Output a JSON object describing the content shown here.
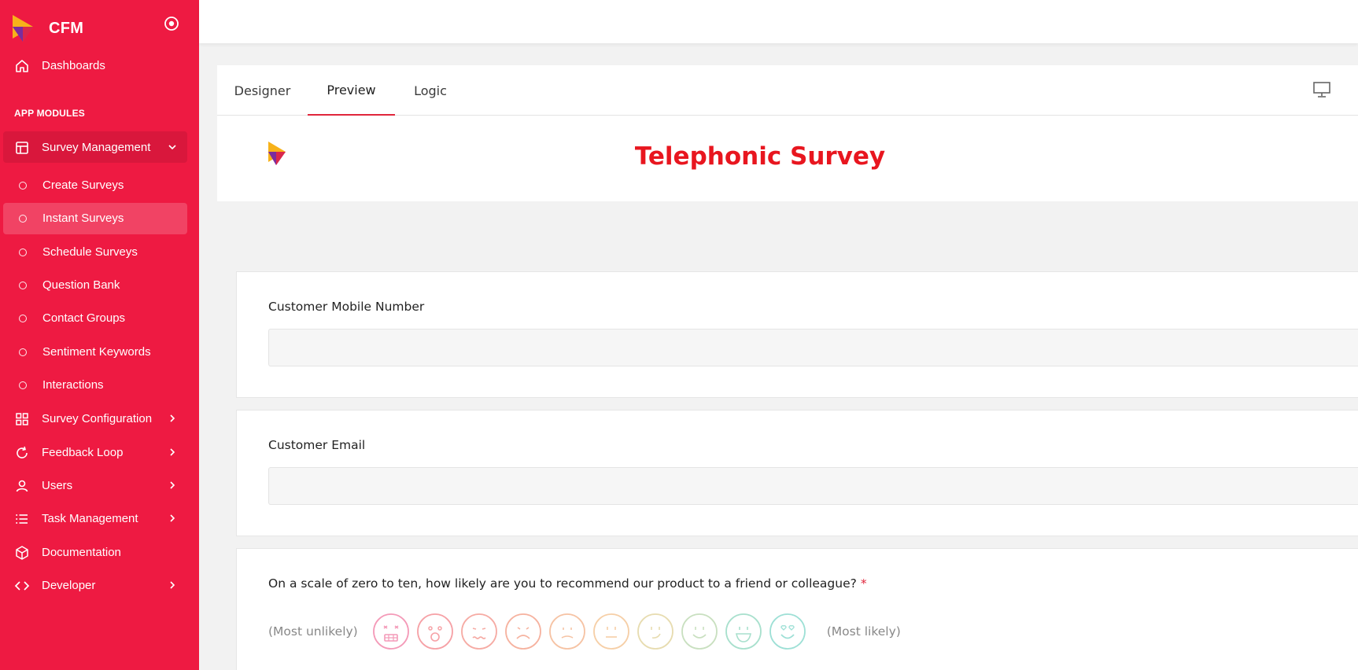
{
  "app": {
    "name": "CFM"
  },
  "sidebar": {
    "dashboards": "Dashboards",
    "section_title": "APP MODULES",
    "survey_management": "Survey Management",
    "sub_items": [
      {
        "label": "Create Surveys"
      },
      {
        "label": "Instant Surveys"
      },
      {
        "label": "Schedule Surveys"
      },
      {
        "label": "Question Bank"
      },
      {
        "label": "Contact Groups"
      },
      {
        "label": "Sentiment Keywords"
      },
      {
        "label": "Interactions"
      }
    ],
    "survey_configuration": "Survey Configuration",
    "feedback_loop": "Feedback Loop",
    "users": "Users",
    "task_management": "Task Management",
    "documentation": "Documentation",
    "developer": "Developer",
    "accent_color": "#ee1a42"
  },
  "tabs": {
    "designer": "Designer",
    "preview": "Preview",
    "logic": "Logic"
  },
  "survey": {
    "title": "Telephonic Survey",
    "title_color": "#e8161f",
    "questions": {
      "mobile": {
        "label": "Customer Mobile Number"
      },
      "email": {
        "label": "Customer Email"
      },
      "nps": {
        "label": "On a scale of zero to ten, how likely are you to recommend our product to a friend or colleague?",
        "required_mark": "*",
        "low_label": "(Most unlikely)",
        "high_label": "(Most likely)",
        "faces": [
          "very-angry-face-icon",
          "shocked-face-icon",
          "disgusted-face-icon",
          "sad-face-icon",
          "slightly-sad-face-icon",
          "neutral-face-icon",
          "slight-smile-face-icon",
          "smile-face-icon",
          "grin-face-icon",
          "heart-eyes-face-icon"
        ]
      }
    }
  }
}
